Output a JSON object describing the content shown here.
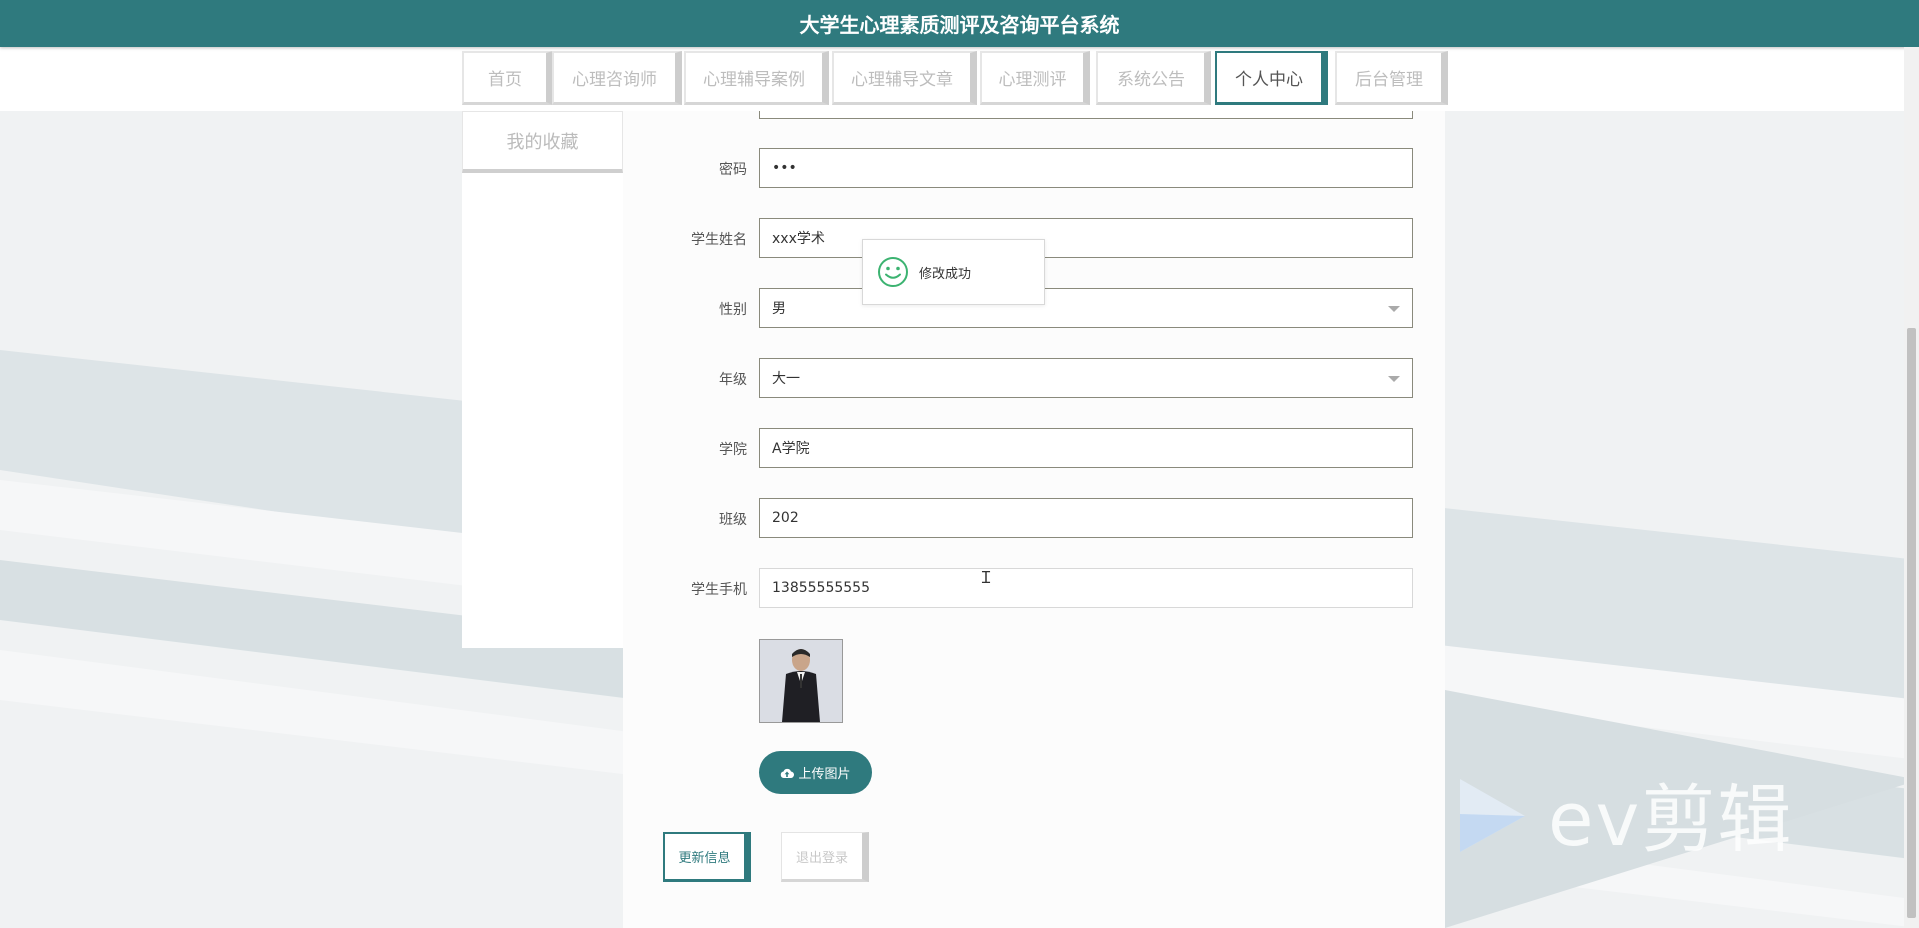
{
  "header": {
    "title": "大学生心理素质测评及咨询平台系统"
  },
  "nav": {
    "items": [
      {
        "label": "首页",
        "active": false
      },
      {
        "label": "心理咨询师",
        "active": false
      },
      {
        "label": "心理辅导案例",
        "active": false
      },
      {
        "label": "心理辅导文章",
        "active": false
      },
      {
        "label": "心理测评",
        "active": false
      },
      {
        "label": "系统公告",
        "active": false
      },
      {
        "label": "个人中心",
        "active": true
      },
      {
        "label": "后台管理",
        "active": false
      }
    ]
  },
  "sidebar": {
    "items": [
      {
        "label": "我的收藏"
      }
    ]
  },
  "form": {
    "fields": [
      {
        "label": "密码",
        "value": "•••",
        "type": "password"
      },
      {
        "label": "学生姓名",
        "value": "xxx学术",
        "type": "text"
      },
      {
        "label": "性别",
        "value": "男",
        "type": "select"
      },
      {
        "label": "年级",
        "value": "大一",
        "type": "select"
      },
      {
        "label": "学院",
        "value": "A学院",
        "type": "text"
      },
      {
        "label": "班级",
        "value": "202",
        "type": "text"
      },
      {
        "label": "学生手机",
        "value": "13855555555",
        "type": "text"
      }
    ],
    "upload_label": "上传图片",
    "update_label": "更新信息",
    "logout_label": "退出登录"
  },
  "toast": {
    "message": "修改成功"
  },
  "watermark": {
    "text": "ev剪辑"
  },
  "colors": {
    "primary": "#2f7a7e",
    "success": "#3cb371"
  }
}
